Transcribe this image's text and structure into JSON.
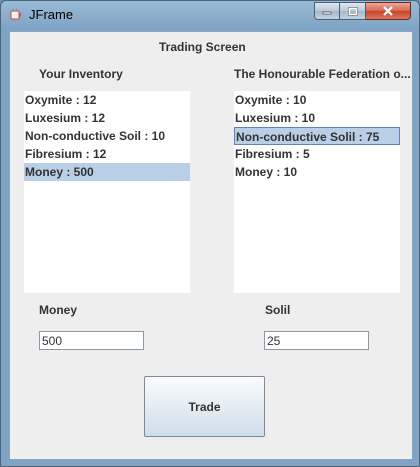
{
  "window": {
    "title": "JFrame"
  },
  "screen": {
    "title": "Trading Screen"
  },
  "left_panel": {
    "heading": "Your Inventory",
    "items": [
      {
        "label": "Oxymite : 12",
        "selected": false
      },
      {
        "label": "Luxesium : 12",
        "selected": false
      },
      {
        "label": "Non-conductive Soil : 10",
        "selected": false
      },
      {
        "label": "Fibresium : 12",
        "selected": false
      },
      {
        "label": "Money : 500",
        "selected": true
      }
    ]
  },
  "right_panel": {
    "heading": "The Honourable Federation o...",
    "items": [
      {
        "label": "Oxymite : 10",
        "selected": false
      },
      {
        "label": "Luxesium : 10",
        "selected": false
      },
      {
        "label": "Non-conductive Solil : 75",
        "selected": true
      },
      {
        "label": "Fibresium : 5",
        "selected": false
      },
      {
        "label": "Money : 10",
        "selected": false
      }
    ]
  },
  "left_field": {
    "label": "Money",
    "value": "500"
  },
  "right_field": {
    "label": "Solil",
    "value": "25"
  },
  "trade_button": {
    "label": "Trade"
  }
}
